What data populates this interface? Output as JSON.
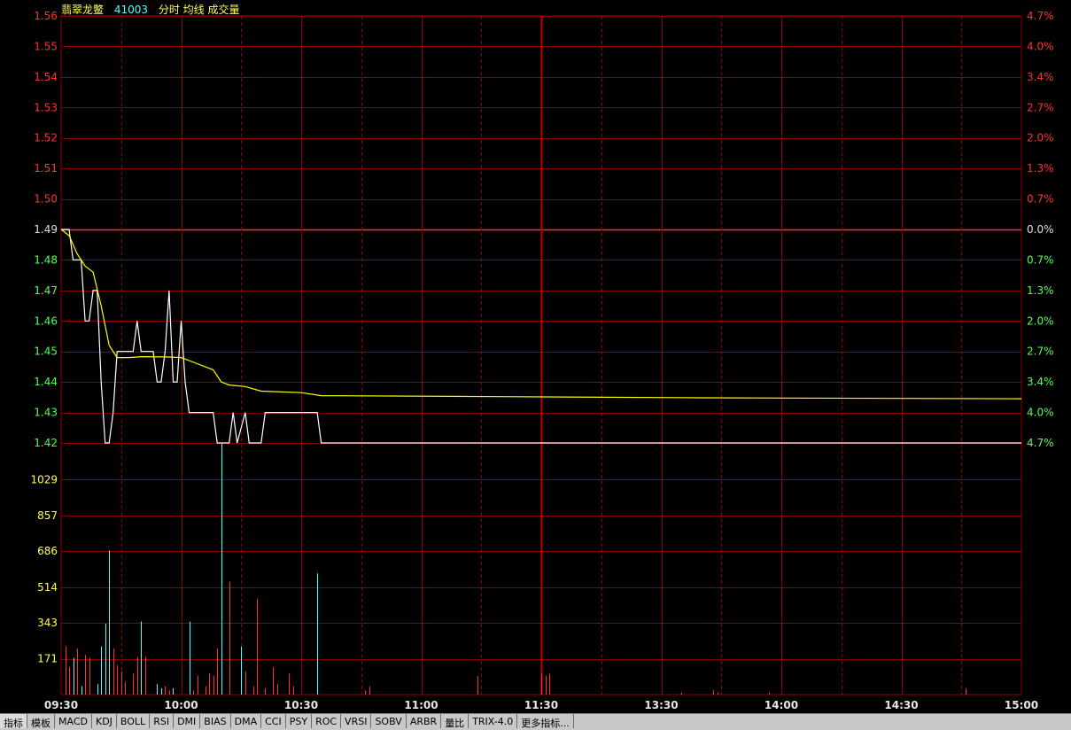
{
  "header": {
    "stock_name": "翡翠龙鳖",
    "stock_code": "41003",
    "chart_title": "分时 均线 成交量"
  },
  "colors": {
    "up": "#ff3232",
    "down": "#54ff54",
    "grid": "#8b0000",
    "price_line": "#ffffff",
    "avg_line": "#ffff00",
    "volume_up": "#ff3232",
    "volume_down": "#54ffff",
    "volume_axis": "#ffff55",
    "zero": "#e0e0e0"
  },
  "tabs": [
    "指标",
    "模板",
    "MACD",
    "KDJ",
    "BOLL",
    "RSI",
    "DMI",
    "BIAS",
    "DMA",
    "CCI",
    "PSY",
    "ROC",
    "VRSI",
    "SOBV",
    "ARBR",
    "量比",
    "TRIX-4.0",
    "更多指标..."
  ],
  "chart_data": {
    "type": "line",
    "prev_close": 1.49,
    "price_ticks": [
      1.56,
      1.55,
      1.54,
      1.53,
      1.52,
      1.51,
      1.5,
      1.49,
      1.48,
      1.47,
      1.46,
      1.45,
      1.44,
      1.43,
      1.42
    ],
    "price_tick_labels": [
      "1.56",
      "1.55",
      "1.54",
      "1.53",
      "1.52",
      "1.51",
      "1.50",
      "1.49",
      "1.48",
      "1.47",
      "1.46",
      "1.45",
      "1.44",
      "1.43",
      "1.42"
    ],
    "pct_labels": [
      "4.7%",
      "4.0%",
      "3.4%",
      "2.7%",
      "2.0%",
      "1.3%",
      "0.7%",
      "0.0%",
      "0.7%",
      "1.3%",
      "2.0%",
      "2.7%",
      "3.4%",
      "4.0%",
      "4.7%"
    ],
    "volume_ticks": [
      1029,
      857,
      686,
      514,
      343,
      171
    ],
    "volume_max": 1200,
    "x_tick_labels": [
      "09:30",
      "10:00",
      "10:30",
      "11:00",
      "11:30",
      "13:30",
      "14:00",
      "14:30",
      "15:00"
    ],
    "total_minutes": 240,
    "series": [
      {
        "name": "",
        "kind": "price",
        "points": [
          [
            0,
            1.49
          ],
          [
            2,
            1.49
          ],
          [
            3,
            1.48
          ],
          [
            4,
            1.48
          ],
          [
            5,
            1.48
          ],
          [
            6,
            1.46
          ],
          [
            7,
            1.46
          ],
          [
            8,
            1.47
          ],
          [
            9,
            1.47
          ],
          [
            10,
            1.44
          ],
          [
            11,
            1.42
          ],
          [
            12,
            1.42
          ],
          [
            13,
            1.43
          ],
          [
            14,
            1.45
          ],
          [
            17,
            1.45
          ],
          [
            18,
            1.45
          ],
          [
            19,
            1.46
          ],
          [
            20,
            1.45
          ],
          [
            23,
            1.45
          ],
          [
            24,
            1.44
          ],
          [
            25,
            1.44
          ],
          [
            26,
            1.45
          ],
          [
            27,
            1.47
          ],
          [
            28,
            1.44
          ],
          [
            29,
            1.44
          ],
          [
            30,
            1.46
          ],
          [
            31,
            1.44
          ],
          [
            32,
            1.43
          ],
          [
            38,
            1.43
          ],
          [
            39,
            1.42
          ],
          [
            42,
            1.42
          ],
          [
            43,
            1.43
          ],
          [
            44,
            1.42
          ],
          [
            46,
            1.43
          ],
          [
            47,
            1.42
          ],
          [
            50,
            1.42
          ],
          [
            51,
            1.43
          ],
          [
            64,
            1.43
          ],
          [
            65,
            1.42
          ],
          [
            240,
            1.42
          ]
        ]
      },
      {
        "name": "",
        "kind": "avg",
        "points": [
          [
            0,
            1.49
          ],
          [
            2,
            1.488
          ],
          [
            4,
            1.482
          ],
          [
            6,
            1.478
          ],
          [
            8,
            1.476
          ],
          [
            10,
            1.465
          ],
          [
            12,
            1.452
          ],
          [
            14,
            1.448
          ],
          [
            17,
            1.448
          ],
          [
            20,
            1.4483
          ],
          [
            26,
            1.4482
          ],
          [
            30,
            1.448
          ],
          [
            34,
            1.446
          ],
          [
            38,
            1.444
          ],
          [
            40,
            1.44
          ],
          [
            42,
            1.439
          ],
          [
            46,
            1.4385
          ],
          [
            50,
            1.437
          ],
          [
            60,
            1.4365
          ],
          [
            65,
            1.4355
          ],
          [
            110,
            1.4352
          ],
          [
            160,
            1.4348
          ],
          [
            240,
            1.4345
          ]
        ]
      }
    ],
    "volume": [
      [
        1,
        230,
        "up"
      ],
      [
        2,
        130,
        "up"
      ],
      [
        3,
        175,
        "down"
      ],
      [
        4,
        220,
        "up"
      ],
      [
        5,
        40,
        "down"
      ],
      [
        6,
        190,
        "up"
      ],
      [
        7,
        175,
        "up"
      ],
      [
        9,
        50,
        "down"
      ],
      [
        10,
        230,
        "down"
      ],
      [
        11,
        340,
        "down"
      ],
      [
        12,
        690,
        "down"
      ],
      [
        13,
        220,
        "up"
      ],
      [
        14,
        140,
        "up"
      ],
      [
        15,
        110,
        "up"
      ],
      [
        16,
        60,
        "up"
      ],
      [
        18,
        100,
        "up"
      ],
      [
        19,
        180,
        "up"
      ],
      [
        20,
        350,
        "down"
      ],
      [
        21,
        180,
        "up"
      ],
      [
        24,
        50,
        "down"
      ],
      [
        25,
        30,
        "down"
      ],
      [
        26,
        40,
        "up"
      ],
      [
        27,
        20,
        "up"
      ],
      [
        28,
        30,
        "down"
      ],
      [
        32,
        350,
        "down"
      ],
      [
        33,
        20,
        "up"
      ],
      [
        34,
        90,
        "up"
      ],
      [
        36,
        40,
        "up"
      ],
      [
        37,
        100,
        "up"
      ],
      [
        38,
        90,
        "up"
      ],
      [
        39,
        220,
        "up"
      ],
      [
        40,
        1200,
        "down"
      ],
      [
        42,
        540,
        "up"
      ],
      [
        45,
        230,
        "down"
      ],
      [
        46,
        110,
        "up"
      ],
      [
        48,
        40,
        "up"
      ],
      [
        49,
        460,
        "up"
      ],
      [
        51,
        30,
        "up"
      ],
      [
        53,
        130,
        "up"
      ],
      [
        54,
        50,
        "up"
      ],
      [
        57,
        100,
        "up"
      ],
      [
        58,
        40,
        "up"
      ],
      [
        64,
        580,
        "down"
      ],
      [
        76,
        20,
        "up"
      ],
      [
        77,
        40,
        "up"
      ],
      [
        104,
        90,
        "up"
      ],
      [
        120,
        100,
        "up"
      ],
      [
        121,
        90,
        "up"
      ],
      [
        122,
        100,
        "up"
      ],
      [
        155,
        10,
        "up"
      ],
      [
        163,
        20,
        "up"
      ],
      [
        164,
        10,
        "up"
      ],
      [
        177,
        10,
        "up"
      ],
      [
        226,
        30,
        "up"
      ]
    ]
  }
}
